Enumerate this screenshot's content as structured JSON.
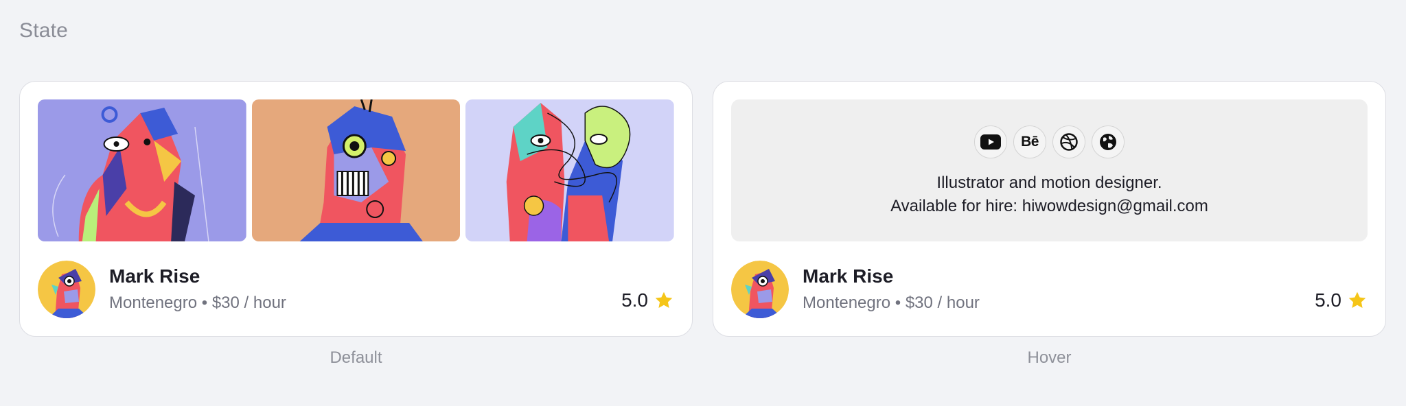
{
  "section_title": "State",
  "cards": [
    {
      "state_label": "Default",
      "name": "Mark Rise",
      "meta": "Montenegro • $30 / hour",
      "rating": "5.0"
    },
    {
      "state_label": "Hover",
      "name": "Mark Rise",
      "meta": "Montenegro • $30 / hour",
      "rating": "5.0",
      "bio_line1": "Illustrator and motion designer.",
      "bio_line2": "Available for hire: hiwowdesign@gmail.com",
      "socials": [
        "youtube-icon",
        "behance-icon",
        "dribbble-icon",
        "globe-icon"
      ],
      "behance_text": "Bē"
    }
  ],
  "colors": {
    "background": "#f2f3f6",
    "card": "#ffffff",
    "star": "#f5c518",
    "thumb1_bg": "#9b9ae8",
    "thumb2_bg": "#e5a87c",
    "thumb3_bg": "#d2d3f8"
  }
}
